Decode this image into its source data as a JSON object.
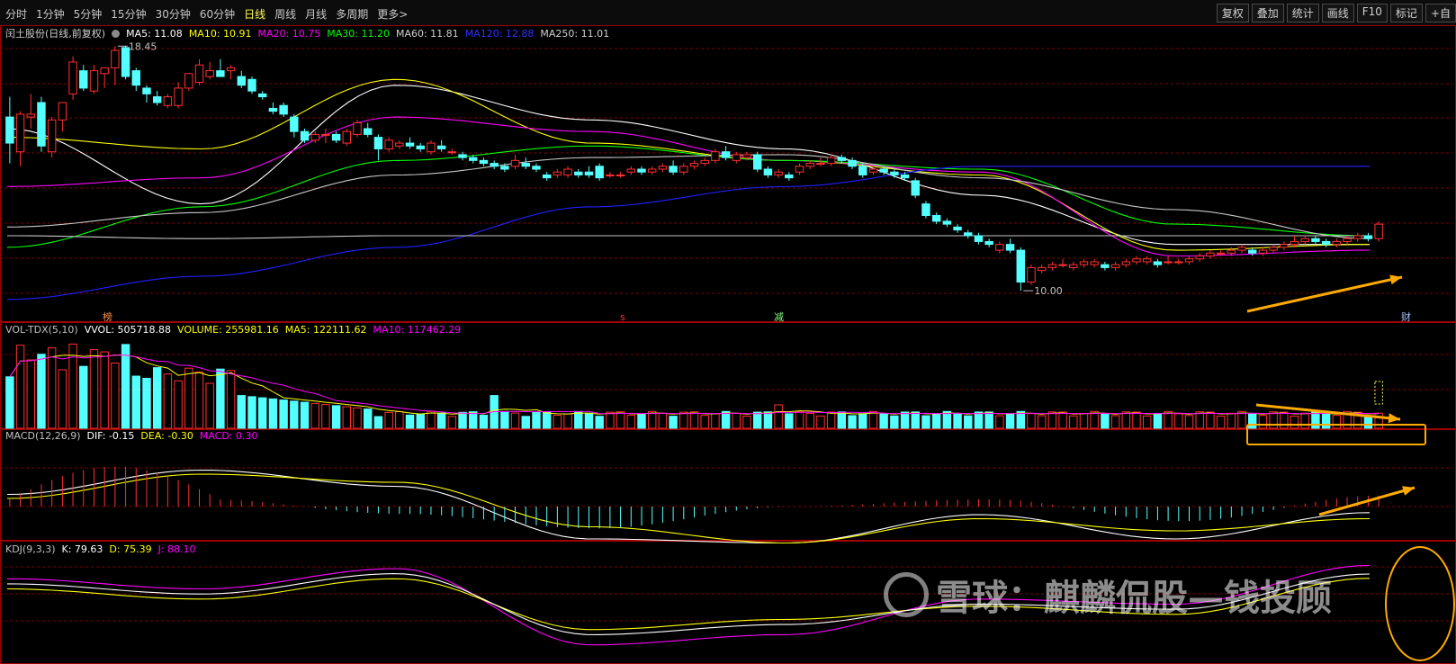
{
  "toolbar": {
    "periods": [
      "分时",
      "1分钟",
      "5分钟",
      "15分钟",
      "30分钟",
      "60分钟",
      "日线",
      "周线",
      "月线",
      "多周期",
      "更多>"
    ],
    "active": "日线",
    "tools": [
      "复权",
      "叠加",
      "统计",
      "画线",
      "F10",
      "标记",
      "+自"
    ]
  },
  "price_header": {
    "stock": "闰土股份(日线,前复权)",
    "ma": [
      {
        "label": "MA5: 11.08",
        "color": "#ffffff"
      },
      {
        "label": "MA10: 10.91",
        "color": "#ffff00"
      },
      {
        "label": "MA20: 10.75",
        "color": "#ff00ff"
      },
      {
        "label": "MA30: 11.20",
        "color": "#00ff00"
      },
      {
        "label": "MA60: 11.81",
        "color": "#d0d0d0"
      },
      {
        "label": "MA120: 12.88",
        "color": "#3030ff"
      },
      {
        "label": "MA250: 11.01",
        "color": "#d0d0d0"
      }
    ]
  },
  "vol_header": {
    "items": [
      {
        "label": "VOL-TDX(5,10)",
        "color": "#c0c0c0"
      },
      {
        "label": "VVOL: 505718.88",
        "color": "#ffffff"
      },
      {
        "label": "VOLUME: 255981.16",
        "color": "#ffff00"
      },
      {
        "label": "MA5: 122111.62",
        "color": "#ffff00"
      },
      {
        "label": "MA10: 117462.29",
        "color": "#ff00ff"
      }
    ]
  },
  "macd_header": {
    "items": [
      {
        "label": "MACD(12,26,9)",
        "color": "#c0c0c0"
      },
      {
        "label": "DIF: -0.15",
        "color": "#ffffff"
      },
      {
        "label": "DEA: -0.30",
        "color": "#ffff00"
      },
      {
        "label": "MACD: 0.30",
        "color": "#ff00ff"
      }
    ]
  },
  "kdj_header": {
    "items": [
      {
        "label": "KDJ(9,3,3)",
        "color": "#c0c0c0"
      },
      {
        "label": "K: 79.63",
        "color": "#ffffff"
      },
      {
        "label": "D: 75.39",
        "color": "#ffff00"
      },
      {
        "label": "J: 88.10",
        "color": "#ff00ff"
      }
    ]
  },
  "annotations": {
    "high": "18.45",
    "low": "10.00",
    "markers": [
      "榜",
      "s",
      "减",
      "财"
    ]
  },
  "watermark": "雪球：麒麟侃股—钱投顾",
  "colors": {
    "up": "#ff3030",
    "down": "#54ffff",
    "background": "#000000",
    "grid": "#800000"
  },
  "chart_data": {
    "type": "candlestick",
    "candles": [
      [
        16.0,
        16.7,
        14.4,
        15.1
      ],
      [
        14.8,
        16.2,
        14.3,
        16.1
      ],
      [
        16.0,
        16.8,
        15.6,
        16.1
      ],
      [
        16.5,
        16.7,
        14.8,
        15.0
      ],
      [
        14.8,
        16.0,
        14.6,
        15.9
      ],
      [
        15.9,
        16.5,
        15.5,
        16.5
      ],
      [
        16.8,
        18.1,
        16.6,
        17.9
      ],
      [
        17.6,
        17.8,
        16.9,
        17.0
      ],
      [
        16.9,
        17.8,
        16.8,
        17.6
      ],
      [
        17.5,
        17.7,
        17.0,
        17.7
      ],
      [
        17.7,
        18.45,
        17.1,
        18.3
      ],
      [
        18.4,
        18.45,
        17.3,
        17.4
      ],
      [
        17.6,
        17.7,
        16.9,
        17.1
      ],
      [
        17.0,
        17.1,
        16.5,
        16.8
      ],
      [
        16.7,
        16.9,
        16.4,
        16.5
      ],
      [
        16.4,
        16.8,
        16.3,
        16.7
      ],
      [
        16.4,
        17.2,
        16.3,
        17.0
      ],
      [
        17.0,
        17.5,
        16.9,
        17.5
      ],
      [
        17.2,
        18.0,
        17.1,
        17.8
      ],
      [
        17.4,
        17.9,
        17.3,
        17.6
      ],
      [
        17.6,
        18.0,
        17.4,
        17.4
      ],
      [
        17.6,
        17.8,
        17.3,
        17.7
      ],
      [
        17.4,
        17.6,
        17.0,
        17.1
      ],
      [
        17.3,
        17.4,
        16.8,
        16.9
      ],
      [
        16.8,
        16.9,
        16.6,
        16.7
      ],
      [
        16.3,
        16.5,
        16.1,
        16.2
      ],
      [
        16.4,
        16.5,
        16.0,
        16.1
      ],
      [
        16.0,
        16.1,
        15.3,
        15.5
      ],
      [
        15.5,
        15.6,
        15.1,
        15.2
      ],
      [
        15.2,
        15.5,
        15.1,
        15.4
      ],
      [
        15.4,
        15.6,
        15.1,
        15.4
      ],
      [
        15.4,
        15.5,
        15.1,
        15.2
      ],
      [
        15.1,
        15.6,
        15.0,
        15.5
      ],
      [
        15.4,
        15.9,
        15.3,
        15.8
      ],
      [
        15.6,
        15.8,
        15.3,
        15.4
      ],
      [
        15.3,
        15.4,
        14.5,
        14.9
      ],
      [
        14.9,
        15.3,
        14.8,
        15.2
      ],
      [
        15.0,
        15.2,
        14.9,
        15.1
      ],
      [
        15.1,
        15.3,
        14.9,
        15.0
      ],
      [
        15.0,
        15.1,
        14.8,
        14.9
      ],
      [
        14.8,
        15.2,
        14.7,
        15.1
      ],
      [
        15.0,
        15.2,
        14.8,
        14.9
      ],
      [
        14.8,
        14.9,
        14.7,
        14.8
      ],
      [
        14.7,
        14.8,
        14.5,
        14.6
      ],
      [
        14.6,
        14.7,
        14.4,
        14.5
      ],
      [
        14.5,
        14.6,
        14.3,
        14.4
      ],
      [
        14.4,
        14.5,
        14.2,
        14.3
      ],
      [
        14.3,
        14.4,
        14.1,
        14.2
      ],
      [
        14.3,
        14.7,
        14.2,
        14.5
      ],
      [
        14.4,
        14.6,
        14.2,
        14.3
      ],
      [
        14.3,
        14.4,
        14.1,
        14.2
      ],
      [
        14.0,
        14.1,
        13.8,
        13.9
      ],
      [
        14.0,
        14.2,
        13.9,
        14.1
      ],
      [
        14.0,
        14.3,
        13.9,
        14.2
      ],
      [
        14.1,
        14.2,
        13.9,
        14.0
      ],
      [
        14.1,
        14.3,
        13.9,
        14.0
      ],
      [
        14.3,
        14.4,
        13.8,
        13.9
      ],
      [
        14.0,
        14.1,
        13.9,
        14.0
      ],
      [
        14.0,
        14.1,
        13.9,
        14.0
      ],
      [
        14.1,
        14.3,
        14.0,
        14.2
      ],
      [
        14.2,
        14.3,
        14.0,
        14.1
      ],
      [
        14.1,
        14.3,
        14.0,
        14.2
      ],
      [
        14.2,
        14.4,
        14.1,
        14.3
      ],
      [
        14.3,
        14.5,
        14.0,
        14.1
      ],
      [
        14.1,
        14.4,
        14.0,
        14.3
      ],
      [
        14.3,
        14.5,
        14.2,
        14.4
      ],
      [
        14.4,
        14.6,
        14.3,
        14.5
      ],
      [
        14.5,
        14.9,
        14.4,
        14.8
      ],
      [
        14.8,
        15.0,
        14.5,
        14.6
      ],
      [
        14.5,
        14.8,
        14.4,
        14.7
      ],
      [
        14.6,
        14.8,
        14.5,
        14.7
      ],
      [
        14.7,
        14.8,
        14.1,
        14.2
      ],
      [
        14.2,
        14.3,
        13.9,
        14.0
      ],
      [
        14.0,
        14.2,
        13.9,
        14.1
      ],
      [
        14.0,
        14.1,
        13.8,
        13.9
      ],
      [
        14.1,
        14.4,
        14.0,
        14.3
      ],
      [
        14.3,
        14.5,
        14.2,
        14.4
      ],
      [
        14.4,
        14.6,
        14.3,
        14.4
      ],
      [
        14.4,
        14.7,
        14.3,
        14.6
      ],
      [
        14.6,
        14.7,
        14.4,
        14.5
      ],
      [
        14.5,
        14.6,
        14.2,
        14.3
      ],
      [
        14.3,
        14.4,
        13.9,
        14.0
      ],
      [
        14.1,
        14.3,
        14.0,
        14.2
      ],
      [
        14.2,
        14.3,
        14.0,
        14.1
      ],
      [
        14.1,
        14.2,
        13.9,
        14.0
      ],
      [
        14.0,
        14.1,
        13.8,
        13.9
      ],
      [
        13.8,
        13.9,
        13.2,
        13.3
      ],
      [
        13.0,
        13.1,
        12.5,
        12.6
      ],
      [
        12.6,
        12.7,
        12.3,
        12.4
      ],
      [
        12.4,
        12.5,
        12.2,
        12.3
      ],
      [
        12.2,
        12.3,
        12.0,
        12.1
      ],
      [
        12.0,
        12.1,
        11.8,
        11.9
      ],
      [
        11.9,
        12.0,
        11.6,
        11.7
      ],
      [
        11.7,
        11.8,
        11.5,
        11.6
      ],
      [
        11.4,
        11.7,
        11.3,
        11.6
      ],
      [
        11.6,
        11.8,
        11.3,
        11.4
      ],
      [
        11.4,
        11.5,
        10.0,
        10.3
      ],
      [
        10.3,
        10.9,
        10.2,
        10.8
      ],
      [
        10.7,
        10.9,
        10.6,
        10.8
      ],
      [
        10.8,
        11.0,
        10.7,
        10.9
      ],
      [
        10.9,
        11.1,
        10.8,
        10.9
      ],
      [
        10.8,
        11.0,
        10.7,
        10.9
      ],
      [
        10.9,
        11.1,
        10.8,
        11.0
      ],
      [
        10.9,
        11.1,
        10.8,
        11.0
      ],
      [
        10.9,
        11.0,
        10.7,
        10.8
      ],
      [
        10.8,
        11.0,
        10.7,
        10.9
      ],
      [
        10.9,
        11.1,
        10.8,
        11.0
      ],
      [
        11.0,
        11.2,
        10.9,
        11.1
      ],
      [
        11.0,
        11.2,
        10.9,
        11.1
      ],
      [
        11.0,
        11.1,
        10.8,
        10.9
      ],
      [
        11.0,
        11.2,
        10.9,
        11.0
      ],
      [
        11.0,
        11.1,
        10.9,
        11.0
      ],
      [
        11.0,
        11.2,
        10.9,
        11.1
      ],
      [
        11.1,
        11.3,
        11.0,
        11.2
      ],
      [
        11.2,
        11.4,
        11.1,
        11.3
      ],
      [
        11.3,
        11.4,
        11.2,
        11.3
      ],
      [
        11.3,
        11.5,
        11.2,
        11.4
      ],
      [
        11.4,
        11.6,
        11.3,
        11.5
      ],
      [
        11.4,
        11.5,
        11.2,
        11.3
      ],
      [
        11.3,
        11.5,
        11.2,
        11.4
      ],
      [
        11.4,
        11.6,
        11.3,
        11.5
      ],
      [
        11.5,
        11.7,
        11.4,
        11.6
      ],
      [
        11.6,
        11.9,
        11.5,
        11.7
      ],
      [
        11.7,
        11.9,
        11.6,
        11.8
      ],
      [
        11.8,
        11.9,
        11.6,
        11.7
      ],
      [
        11.7,
        11.8,
        11.5,
        11.6
      ],
      [
        11.6,
        11.8,
        11.5,
        11.7
      ],
      [
        11.7,
        11.9,
        11.6,
        11.8
      ],
      [
        11.8,
        12.0,
        11.7,
        11.9
      ],
      [
        11.9,
        12.0,
        11.7,
        11.8
      ],
      [
        11.8,
        12.4,
        11.7,
        12.3
      ]
    ],
    "ma_lines": {
      "MA5": [
        15.6,
        13.0,
        17.1,
        15.9,
        14.9,
        13.3,
        11.6,
        11.6
      ],
      "MA10": [
        15.3,
        14.9,
        17.3,
        15.1,
        14.5,
        14.0,
        11.4,
        11.6
      ],
      "MA20": [
        13.6,
        13.9,
        16.0,
        15.5,
        14.5,
        14.1,
        11.2,
        11.4
      ],
      "MA30": [
        11.5,
        12.9,
        14.5,
        15.0,
        14.5,
        14.2,
        12.3,
        11.9
      ],
      "MA60": [
        12.2,
        12.7,
        14.0,
        14.6,
        14.7,
        13.9,
        12.8,
        11.8
      ],
      "MA120": [
        9.7,
        10.5,
        11.5,
        12.9,
        13.6,
        14.3,
        14.3,
        14.3
      ],
      "MA250": [
        11.9,
        11.8,
        11.9,
        11.9,
        11.9,
        11.9,
        11.9,
        11.9
      ]
    },
    "volume": [],
    "macd": {
      "dif": [
        0.3,
        0.9,
        0.5,
        -0.8,
        -0.9,
        -0.2,
        -0.8,
        -0.15
      ],
      "dea": [
        0.2,
        0.8,
        0.6,
        -0.5,
        -0.9,
        -0.3,
        -0.6,
        -0.3
      ]
    },
    "kdj": {
      "k": [
        70,
        60,
        80,
        20,
        30,
        50,
        45,
        79.63
      ],
      "d": [
        65,
        55,
        75,
        25,
        35,
        48,
        40,
        75.39
      ],
      "j": [
        75,
        65,
        85,
        10,
        20,
        55,
        50,
        88.1
      ]
    }
  }
}
